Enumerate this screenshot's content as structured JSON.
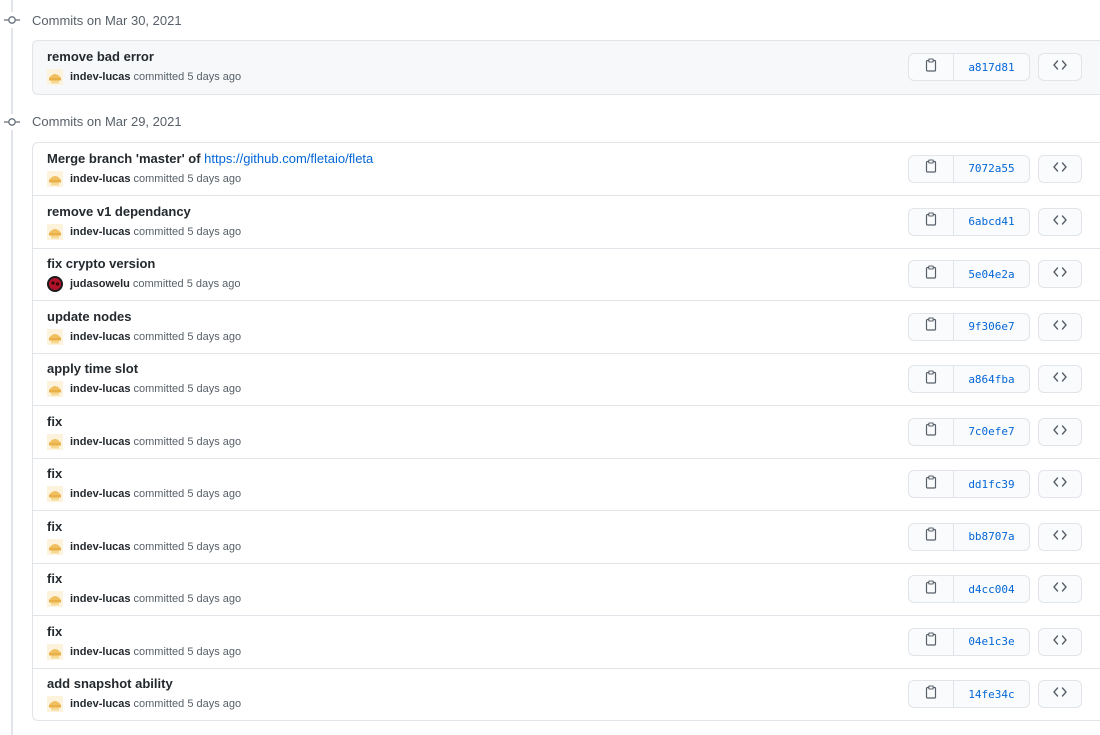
{
  "groups": [
    {
      "header": "Commits on Mar 30, 2021",
      "commits": [
        {
          "title": "remove bad error",
          "author": "indev-lucas",
          "meta": "committed 5 days ago",
          "sha": "a817d81",
          "avatar": "indev"
        }
      ]
    },
    {
      "header": "Commits on Mar 29, 2021",
      "commits": [
        {
          "title": "Merge branch 'master' of ",
          "link": "https://github.com/fletaio/fleta",
          "author": "indev-lucas",
          "meta": "committed 5 days ago",
          "sha": "7072a55",
          "avatar": "indev"
        },
        {
          "title": "remove v1 dependancy",
          "author": "indev-lucas",
          "meta": "committed 5 days ago",
          "sha": "6abcd41",
          "avatar": "indev"
        },
        {
          "title": "fix crypto version",
          "author": "judasowelu",
          "meta": "committed 5 days ago",
          "sha": "5e04e2a",
          "avatar": "judas"
        },
        {
          "title": "update nodes",
          "author": "indev-lucas",
          "meta": "committed 5 days ago",
          "sha": "9f306e7",
          "avatar": "indev"
        },
        {
          "title": "apply time slot",
          "author": "indev-lucas",
          "meta": "committed 5 days ago",
          "sha": "a864fba",
          "avatar": "indev"
        },
        {
          "title": "fix",
          "author": "indev-lucas",
          "meta": "committed 5 days ago",
          "sha": "7c0efe7",
          "avatar": "indev"
        },
        {
          "title": "fix",
          "author": "indev-lucas",
          "meta": "committed 5 days ago",
          "sha": "dd1fc39",
          "avatar": "indev"
        },
        {
          "title": "fix",
          "author": "indev-lucas",
          "meta": "committed 5 days ago",
          "sha": "bb8707a",
          "avatar": "indev"
        },
        {
          "title": "fix",
          "author": "indev-lucas",
          "meta": "committed 5 days ago",
          "sha": "d4cc004",
          "avatar": "indev"
        },
        {
          "title": "fix",
          "author": "indev-lucas",
          "meta": "committed 5 days ago",
          "sha": "04e1c3e",
          "avatar": "indev"
        },
        {
          "title": "add snapshot ability",
          "author": "indev-lucas",
          "meta": "committed 5 days ago",
          "sha": "14fe34c",
          "avatar": "indev"
        }
      ]
    }
  ],
  "icons": {
    "group": "git-commit-icon",
    "copy": "clipboard-icon",
    "browse": "code-icon"
  },
  "colors": {
    "link": "#0366d6",
    "sha": "#0366d6",
    "border": "#e1e4e8",
    "muted": "#586069"
  }
}
